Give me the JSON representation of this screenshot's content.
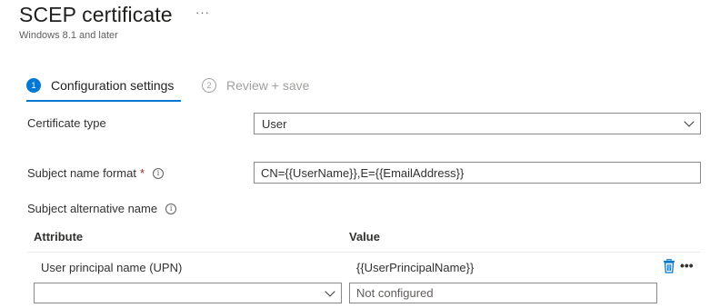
{
  "page": {
    "title": "SCEP certificate",
    "more": "···",
    "subtitle": "Windows 8.1 and later"
  },
  "steps": [
    {
      "number": "1",
      "label": "Configuration settings",
      "active": true
    },
    {
      "number": "2",
      "label": "Review + save",
      "active": false
    }
  ],
  "form": {
    "certificate_type": {
      "label": "Certificate type",
      "value": "User"
    },
    "subject_name_format": {
      "label": "Subject name format",
      "required_mark": "*",
      "value": "CN={{UserName}},E={{EmailAddress}}"
    },
    "subject_alt_name": {
      "label": "Subject alternative name"
    }
  },
  "san_table": {
    "columns": [
      "Attribute",
      "Value"
    ],
    "rows": [
      {
        "attribute": "User principal name (UPN)",
        "value": "{{UserPrincipalName}}"
      }
    ],
    "new_row": {
      "attribute": "",
      "value_placeholder": "Not configured"
    },
    "row_more": "•••"
  },
  "icons": {
    "info": "info-icon",
    "trash": "trash-icon",
    "chevron": "chevron-down-icon",
    "more": "more-icon"
  },
  "colors": {
    "accent": "#0078d4",
    "required": "#a4262c",
    "border": "#8a8886"
  }
}
